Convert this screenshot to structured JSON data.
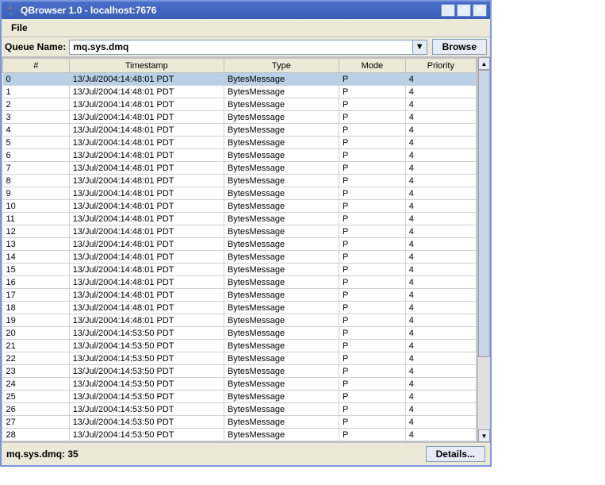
{
  "title": "QBrowser 1.0 - localhost:7676",
  "menu": {
    "file": "File"
  },
  "toolbar": {
    "queue_label": "Queue Name:",
    "queue_value": "mq.sys.dmq",
    "browse_label": "Browse"
  },
  "columns": [
    "#",
    "Timestamp",
    "Type",
    "Mode",
    "Priority"
  ],
  "rows": [
    {
      "n": "0",
      "ts": "13/Jul/2004:14:48:01 PDT",
      "type": "BytesMessage",
      "mode": "P",
      "prio": "4",
      "selected": true
    },
    {
      "n": "1",
      "ts": "13/Jul/2004:14:48:01 PDT",
      "type": "BytesMessage",
      "mode": "P",
      "prio": "4"
    },
    {
      "n": "2",
      "ts": "13/Jul/2004:14:48:01 PDT",
      "type": "BytesMessage",
      "mode": "P",
      "prio": "4"
    },
    {
      "n": "3",
      "ts": "13/Jul/2004:14:48:01 PDT",
      "type": "BytesMessage",
      "mode": "P",
      "prio": "4"
    },
    {
      "n": "4",
      "ts": "13/Jul/2004:14:48:01 PDT",
      "type": "BytesMessage",
      "mode": "P",
      "prio": "4"
    },
    {
      "n": "5",
      "ts": "13/Jul/2004:14:48:01 PDT",
      "type": "BytesMessage",
      "mode": "P",
      "prio": "4"
    },
    {
      "n": "6",
      "ts": "13/Jul/2004:14:48:01 PDT",
      "type": "BytesMessage",
      "mode": "P",
      "prio": "4"
    },
    {
      "n": "7",
      "ts": "13/Jul/2004:14:48:01 PDT",
      "type": "BytesMessage",
      "mode": "P",
      "prio": "4"
    },
    {
      "n": "8",
      "ts": "13/Jul/2004:14:48:01 PDT",
      "type": "BytesMessage",
      "mode": "P",
      "prio": "4"
    },
    {
      "n": "9",
      "ts": "13/Jul/2004:14:48:01 PDT",
      "type": "BytesMessage",
      "mode": "P",
      "prio": "4"
    },
    {
      "n": "10",
      "ts": "13/Jul/2004:14:48:01 PDT",
      "type": "BytesMessage",
      "mode": "P",
      "prio": "4"
    },
    {
      "n": "11",
      "ts": "13/Jul/2004:14:48:01 PDT",
      "type": "BytesMessage",
      "mode": "P",
      "prio": "4"
    },
    {
      "n": "12",
      "ts": "13/Jul/2004:14:48:01 PDT",
      "type": "BytesMessage",
      "mode": "P",
      "prio": "4"
    },
    {
      "n": "13",
      "ts": "13/Jul/2004:14:48:01 PDT",
      "type": "BytesMessage",
      "mode": "P",
      "prio": "4"
    },
    {
      "n": "14",
      "ts": "13/Jul/2004:14:48:01 PDT",
      "type": "BytesMessage",
      "mode": "P",
      "prio": "4"
    },
    {
      "n": "15",
      "ts": "13/Jul/2004:14:48:01 PDT",
      "type": "BytesMessage",
      "mode": "P",
      "prio": "4"
    },
    {
      "n": "16",
      "ts": "13/Jul/2004:14:48:01 PDT",
      "type": "BytesMessage",
      "mode": "P",
      "prio": "4"
    },
    {
      "n": "17",
      "ts": "13/Jul/2004:14:48:01 PDT",
      "type": "BytesMessage",
      "mode": "P",
      "prio": "4"
    },
    {
      "n": "18",
      "ts": "13/Jul/2004:14:48:01 PDT",
      "type": "BytesMessage",
      "mode": "P",
      "prio": "4"
    },
    {
      "n": "19",
      "ts": "13/Jul/2004:14:48:01 PDT",
      "type": "BytesMessage",
      "mode": "P",
      "prio": "4"
    },
    {
      "n": "20",
      "ts": "13/Jul/2004:14:53:50 PDT",
      "type": "BytesMessage",
      "mode": "P",
      "prio": "4"
    },
    {
      "n": "21",
      "ts": "13/Jul/2004:14:53:50 PDT",
      "type": "BytesMessage",
      "mode": "P",
      "prio": "4"
    },
    {
      "n": "22",
      "ts": "13/Jul/2004:14:53:50 PDT",
      "type": "BytesMessage",
      "mode": "P",
      "prio": "4"
    },
    {
      "n": "23",
      "ts": "13/Jul/2004:14:53:50 PDT",
      "type": "BytesMessage",
      "mode": "P",
      "prio": "4"
    },
    {
      "n": "24",
      "ts": "13/Jul/2004:14:53:50 PDT",
      "type": "BytesMessage",
      "mode": "P",
      "prio": "4"
    },
    {
      "n": "25",
      "ts": "13/Jul/2004:14:53:50 PDT",
      "type": "BytesMessage",
      "mode": "P",
      "prio": "4"
    },
    {
      "n": "26",
      "ts": "13/Jul/2004:14:53:50 PDT",
      "type": "BytesMessage",
      "mode": "P",
      "prio": "4"
    },
    {
      "n": "27",
      "ts": "13/Jul/2004:14:53:50 PDT",
      "type": "BytesMessage",
      "mode": "P",
      "prio": "4"
    },
    {
      "n": "28",
      "ts": "13/Jul/2004:14:53:50 PDT",
      "type": "BytesMessage",
      "mode": "P",
      "prio": "4"
    }
  ],
  "status": {
    "text": "mq.sys.dmq: 35",
    "details_label": "Details..."
  }
}
